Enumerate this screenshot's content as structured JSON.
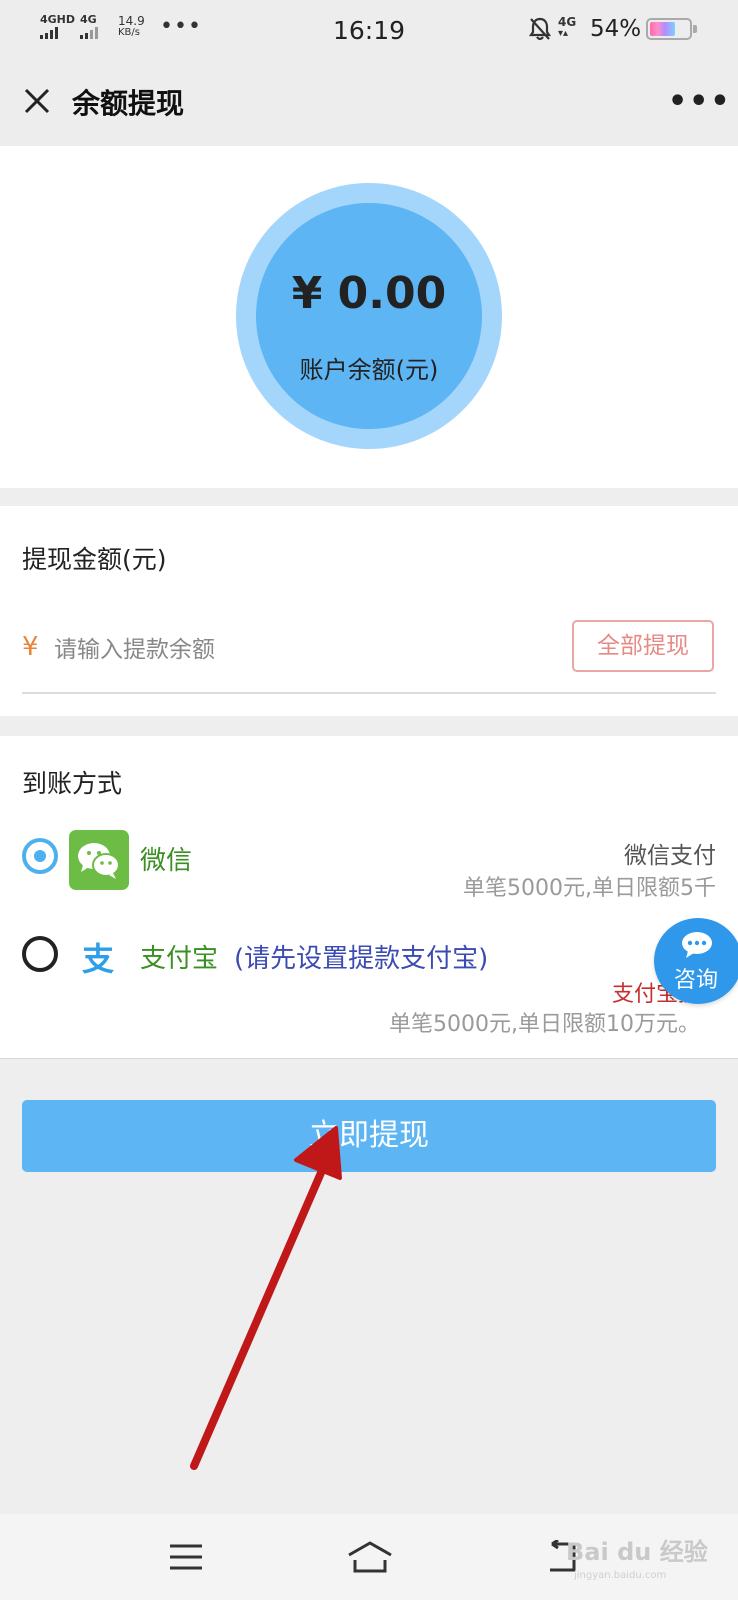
{
  "status_bar": {
    "net1": "4GHD",
    "net2": "4G",
    "speed_value": "14.9",
    "speed_unit": "KB/s",
    "dots": "•••",
    "time": "16:19",
    "net_right": "4G",
    "battery": "54%"
  },
  "header": {
    "title": "余额提现",
    "more": "•••"
  },
  "balance": {
    "amount": "¥ 0.00",
    "label": "账户余额(元)"
  },
  "withdraw": {
    "title": "提现金额(元)",
    "currency": "¥",
    "placeholder": "请输入提款余额",
    "all_label": "全部提现"
  },
  "method": {
    "title": "到账方式",
    "wechat": {
      "name": "微信",
      "right_label": "微信支付",
      "limit": "单笔5000元,单日限额5千"
    },
    "alipay": {
      "name": "支付宝",
      "note": "(请先设置提款支付宝)",
      "right_label": "支付宝提",
      "limit": "单笔5000元,单日限额10万元。"
    }
  },
  "submit_label": "立即提现",
  "consult_label": "咨询",
  "watermark": {
    "brand": "Bai du 经验",
    "sub": "jingyan.baidu.com"
  },
  "colors": {
    "accent": "#5db5f4",
    "wechat_green": "#6cbc45",
    "annotation_red": "#c01818"
  }
}
